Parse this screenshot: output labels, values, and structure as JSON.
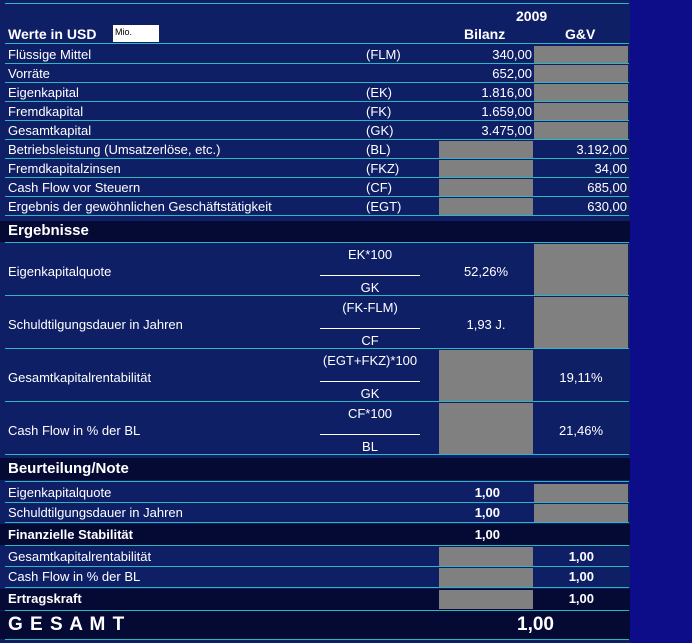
{
  "header": {
    "year": "2009",
    "title": "Werte in USD",
    "unit_box": "Mio.",
    "col_bilanz": "Bilanz",
    "col_guv": "G&V"
  },
  "inputs": [
    {
      "label": "Flüssige Mittel",
      "abbr": "(FLM)",
      "bilanz": "340,00",
      "guv": ""
    },
    {
      "label": "Vorräte",
      "abbr": "",
      "bilanz": "652,00",
      "guv": ""
    },
    {
      "label": "Eigenkapital",
      "abbr": "(EK)",
      "bilanz": "1.816,00",
      "guv": ""
    },
    {
      "label": "Fremdkapital",
      "abbr": "(FK)",
      "bilanz": "1.659,00",
      "guv": ""
    },
    {
      "label": "Gesamtkapital",
      "abbr": "(GK)",
      "bilanz": "3.475,00",
      "guv": ""
    },
    {
      "label": "Betriebsleistung (Umsatzerlöse, etc.)",
      "abbr": "(BL)",
      "bilanz": "",
      "guv": "3.192,00"
    },
    {
      "label": "Fremdkapitalzinsen",
      "abbr": "(FKZ)",
      "bilanz": "",
      "guv": "34,00"
    },
    {
      "label": "Cash Flow vor Steuern",
      "abbr": "(CF)",
      "bilanz": "",
      "guv": "685,00"
    },
    {
      "label": "Ergebnis der gewöhnlichen Geschäftstätigkeit",
      "abbr": "(EGT)",
      "bilanz": "",
      "guv": "630,00"
    }
  ],
  "ergebnisse": {
    "heading": "Ergebnisse",
    "rows": [
      {
        "label": "Eigenkapitalquote",
        "numerator": "EK*100",
        "denominator": "GK",
        "bilanz": "52,26%",
        "guv": ""
      },
      {
        "label": "Schuldtilgungsdauer in Jahren",
        "numerator": "(FK-FLM)",
        "denominator": "CF",
        "bilanz": "1,93 J.",
        "guv": ""
      },
      {
        "label": "Gesamtkapitalrentabilität",
        "numerator": "(EGT+FKZ)*100",
        "denominator": "GK",
        "bilanz": "",
        "guv": "19,11%"
      },
      {
        "label": "Cash Flow in % der BL",
        "numerator": "CF*100",
        "denominator": "BL",
        "bilanz": "",
        "guv": "21,46%"
      }
    ]
  },
  "beurteilung": {
    "heading": "Beurteilung/Note",
    "eigenkapitalquote": {
      "label": "Eigenkapitalquote",
      "value": "1,00"
    },
    "schuldtilgung": {
      "label": "Schuldtilgungsdauer in Jahren",
      "value": "1,00"
    },
    "stabilitaet": {
      "label": "Finanzielle Stabilität",
      "value": "1,00"
    },
    "gkr": {
      "label": "Gesamtkapitalrentabilität",
      "value": "1,00"
    },
    "cfbl": {
      "label": "Cash Flow in % der BL",
      "value": "1,00"
    },
    "ertragskraft": {
      "label": "Ertragskraft",
      "value": "1,00"
    }
  },
  "gesamt": {
    "label": "G E S A M T",
    "value": "1,00"
  },
  "colors": {
    "background": "#0d0d8a",
    "sheet": "#0f1f66",
    "gridline": "#2ab7c2",
    "gray_cell": "#808080",
    "band": "#050a35"
  }
}
